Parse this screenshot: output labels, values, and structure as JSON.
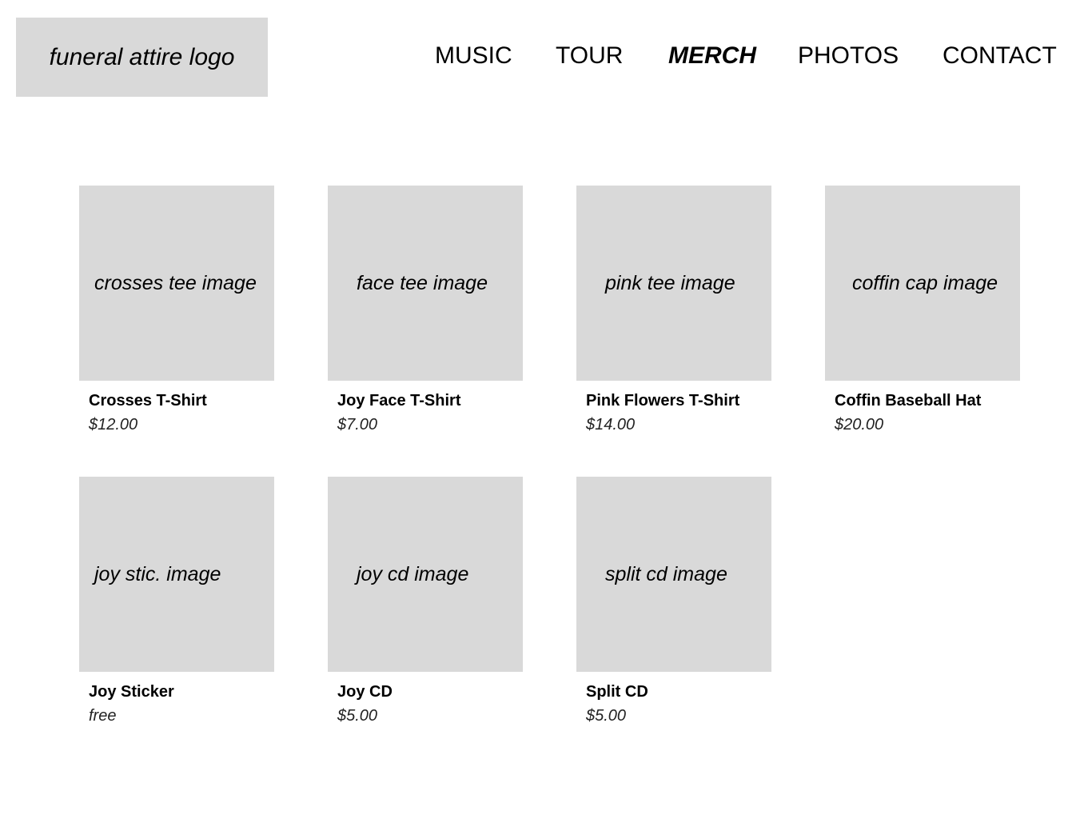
{
  "header": {
    "logo": "funeral attire logo",
    "nav": [
      {
        "label": "MUSIC",
        "active": false
      },
      {
        "label": "TOUR",
        "active": false
      },
      {
        "label": "MERCH",
        "active": true
      },
      {
        "label": "PHOTOS",
        "active": false
      },
      {
        "label": "CONTACT",
        "active": false
      }
    ]
  },
  "products": [
    {
      "image": "crosses tee image",
      "name": "Crosses T-Shirt",
      "price": "$12.00"
    },
    {
      "image": "face tee image",
      "name": "Joy Face T-Shirt",
      "price": "$7.00"
    },
    {
      "image": "pink tee image",
      "name": "Pink Flowers T-Shirt",
      "price": "$14.00"
    },
    {
      "image": "coffin cap image",
      "name": "Coffin Baseball Hat",
      "price": "$20.00"
    },
    {
      "image": "joy stic. image",
      "name": "Joy Sticker",
      "price": "free"
    },
    {
      "image": "joy cd image",
      "name": "Joy CD",
      "price": "$5.00"
    },
    {
      "image": "split cd image",
      "name": "Split CD",
      "price": "$5.00"
    }
  ]
}
